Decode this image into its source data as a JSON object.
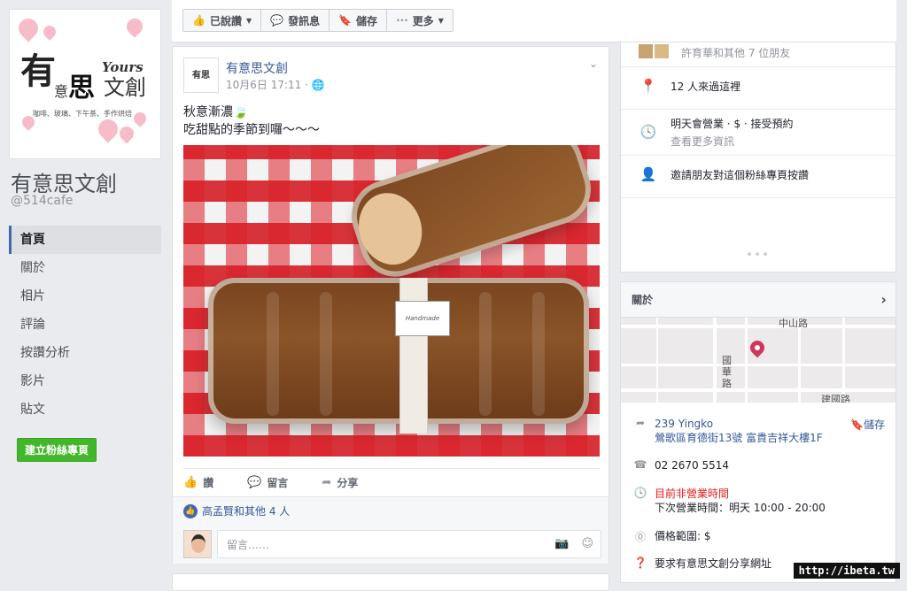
{
  "sidebar": {
    "logo": {
      "main": "有",
      "yours": "Yours",
      "yi": "意",
      "si": "思",
      "wenchuang": "文創",
      "tagline": "咖啡、玻璃、下午茶、手作烘焙"
    },
    "page_name": "有意思文創",
    "handle": "@514cafe",
    "nav": [
      {
        "label": "首頁",
        "active": true
      },
      {
        "label": "關於"
      },
      {
        "label": "相片"
      },
      {
        "label": "評論"
      },
      {
        "label": "按讚分析"
      },
      {
        "label": "影片"
      },
      {
        "label": "貼文"
      }
    ],
    "create_page_label": "建立粉絲專頁"
  },
  "toolbar": {
    "liked_label": "已說讚",
    "message_label": "發訊息",
    "save_label": "儲存",
    "more_label": "更多"
  },
  "post": {
    "author": "有意思文創",
    "timestamp": "10月6日 17:11 ·",
    "text_line1": "秋意漸濃🍃",
    "text_line2": "吃甜點的季節到囉～～～",
    "image_label": "Handmade",
    "like_label": "讚",
    "comment_label": "留言",
    "share_label": "分享",
    "likes_text": "高孟賢和其他 4 人",
    "comment_placeholder": "留言……"
  },
  "right": {
    "friends_text": "許育華和其他 7 位朋友",
    "visits_text": "12 人來過這裡",
    "hours_line1": "明天會營業 · $ · 接受預約",
    "hours_line2": "查看更多資訊",
    "invite_text": "邀請朋友對這個粉絲專頁按讚",
    "about_title": "關於",
    "map_labels": {
      "road1": "中山路",
      "road2": "國華路",
      "road3": "建國路"
    },
    "address_line1": "239 Yingko",
    "address_line2": "鶯歌區育德街13號 富貴吉祥大樓1F",
    "address_save": "儲存",
    "phone": "02 2670 5514",
    "closed_text": "目前非營業時間",
    "next_hours": "下次營業時間：明天 10:00 - 20:00",
    "price_range": "價格範圍: $",
    "share_request": "要求有意思文創分享網址"
  },
  "watermark": "http://ibeta.tw",
  "colors": {
    "brand_blue": "#4267b2",
    "link": "#365899",
    "green": "#42b72a",
    "closed_red": "#e01d1d"
  }
}
